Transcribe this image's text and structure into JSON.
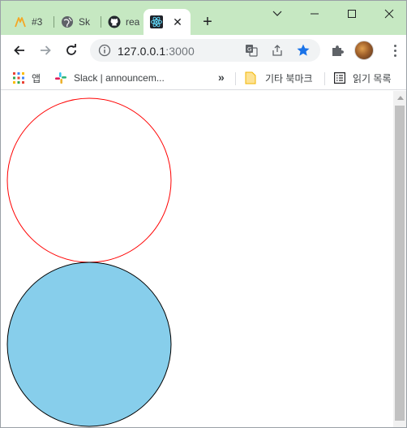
{
  "tabs": [
    {
      "title": "#3",
      "icon": "warning-triangle-icon"
    },
    {
      "title": "Sk",
      "icon": "globe-icon"
    },
    {
      "title": "rea",
      "icon": "github-icon"
    },
    {
      "title": "",
      "icon": "react-icon",
      "active": true
    }
  ],
  "tabstrip": {
    "new_tab_symbol": "+",
    "close_symbol": "✕"
  },
  "toolbar": {
    "url_host": "127.0.0.1",
    "url_port": ":3000"
  },
  "bookmarks": {
    "apps_label": "앱",
    "slack_label": "Slack | announcem...",
    "overflow_symbol": "»",
    "other_label": "기타 북마크",
    "reading_list_label": "읽기 목록"
  },
  "colors": {
    "tabstrip": "#c6e8c2",
    "circle_outline": "#ff0000",
    "circle_fill": "#87ceeb",
    "circle_fill_stroke": "#000000",
    "bookmark_star": "#1a73e8"
  },
  "content": {
    "circles": [
      {
        "name": "outlined-circle",
        "fill": "none",
        "stroke": "#ff0000"
      },
      {
        "name": "filled-circle",
        "fill": "#87ceeb",
        "stroke": "#000000"
      }
    ]
  }
}
